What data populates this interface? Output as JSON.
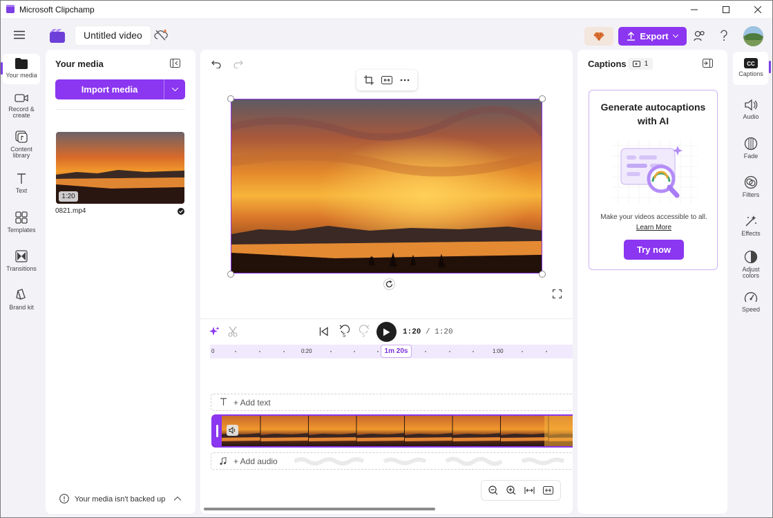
{
  "window": {
    "title": "Microsoft Clipchamp"
  },
  "header": {
    "project_name": "Untitled video",
    "export_label": "Export"
  },
  "left_rail": [
    {
      "label": "Your media",
      "icon": "folder-icon"
    },
    {
      "label": "Record &\ncreate",
      "icon": "camera-icon"
    },
    {
      "label": "Content\nlibrary",
      "icon": "library-icon"
    },
    {
      "label": "Text",
      "icon": "text-icon"
    },
    {
      "label": "Templates",
      "icon": "templates-icon"
    },
    {
      "label": "Transitions",
      "icon": "transitions-icon"
    },
    {
      "label": "Brand kit",
      "icon": "brand-kit-icon"
    }
  ],
  "media": {
    "title": "Your media",
    "import_label": "Import media",
    "items": [
      {
        "name": "0821.mp4",
        "duration": "1:20"
      }
    ],
    "backup_notice": "Your media isn't backed up"
  },
  "player": {
    "current_time": "1:20",
    "separator": "/",
    "total_time": "1:20",
    "rewind_seconds": "5",
    "forward_seconds": "5"
  },
  "timeline": {
    "ruler": [
      "0",
      "0:20",
      "1:00"
    ],
    "playhead_label": "1m 20s",
    "add_text": "+ Add text",
    "add_audio": "+ Add audio"
  },
  "captions": {
    "title": "Captions",
    "count": "1",
    "card_title": "Generate autocaptions with AI",
    "card_desc": "Make your videos accessible to all.",
    "learn_more": "Learn More",
    "try_now": "Try now"
  },
  "right_rail": [
    {
      "label": "Captions",
      "icon": "cc-icon"
    },
    {
      "label": "Audio",
      "icon": "speaker-icon"
    },
    {
      "label": "Fade",
      "icon": "fade-icon"
    },
    {
      "label": "Filters",
      "icon": "filters-icon"
    },
    {
      "label": "Effects",
      "icon": "effects-icon"
    },
    {
      "label": "Adjust\ncolors",
      "icon": "adjust-colors-icon"
    },
    {
      "label": "Speed",
      "icon": "speed-icon"
    }
  ],
  "colors": {
    "accent": "#8b36f0",
    "panel_bg": "#ffffff",
    "app_bg": "#f3f2f7"
  }
}
